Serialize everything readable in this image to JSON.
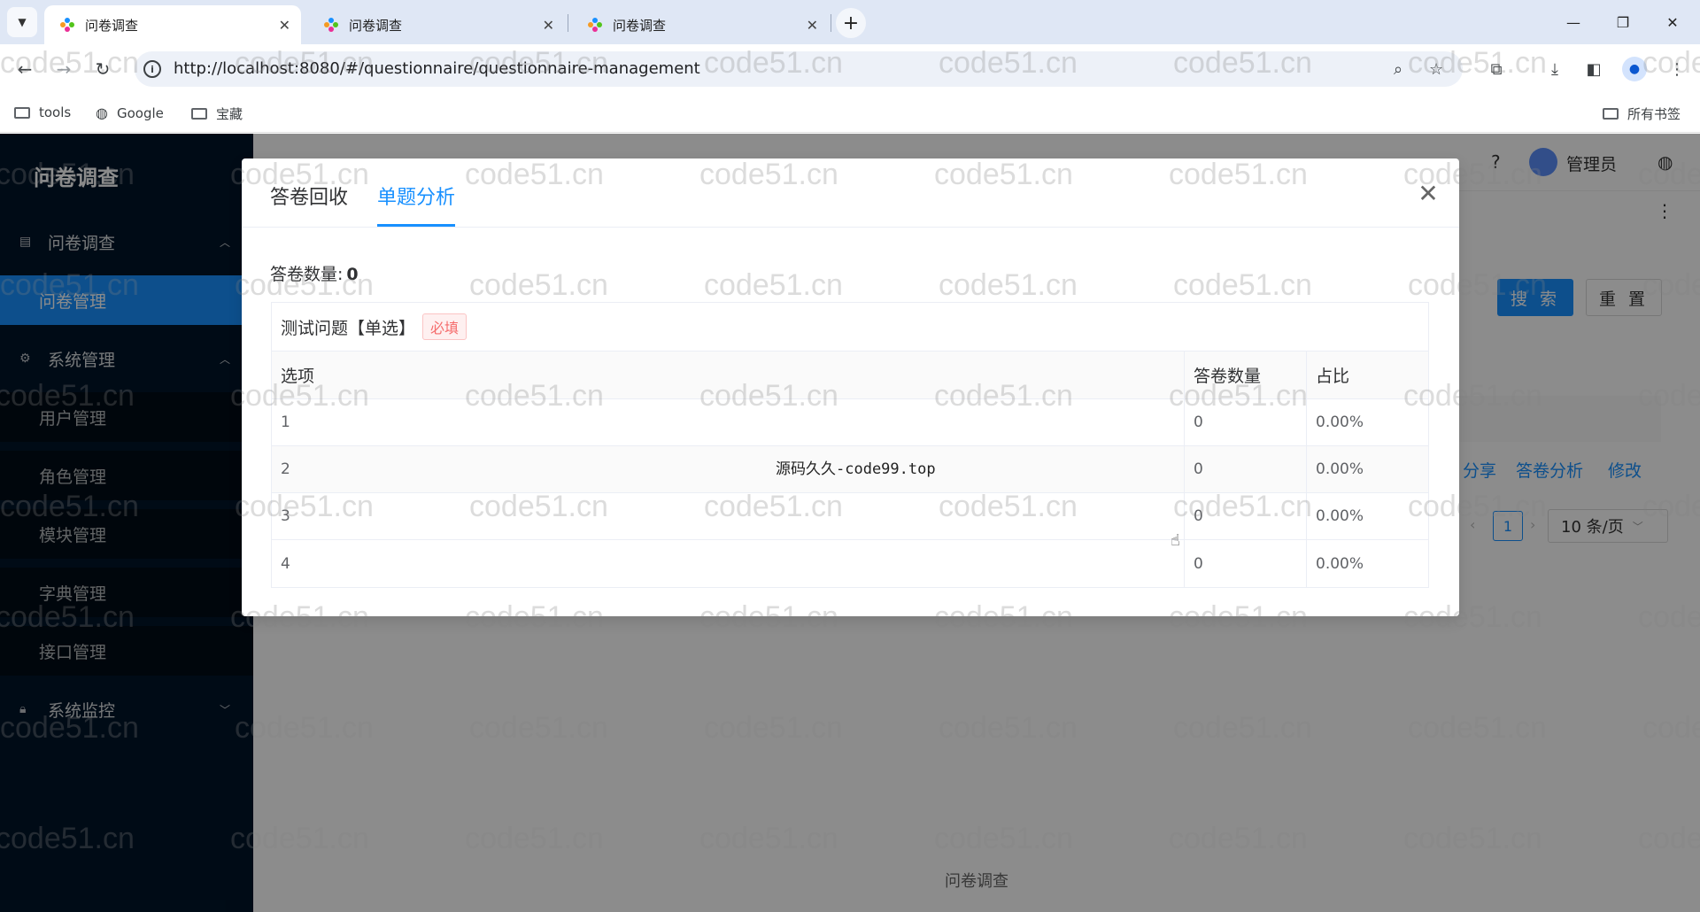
{
  "browser": {
    "tabs": [
      {
        "title": "问卷调查",
        "active": true
      },
      {
        "title": "问卷调查",
        "active": false
      },
      {
        "title": "问卷调查",
        "active": false
      }
    ],
    "url": "http://localhost:8080/#/questionnaire/questionnaire-management",
    "bookmarks": [
      {
        "label": "tools",
        "icon": "folder-icon"
      },
      {
        "label": "Google",
        "icon": "globe-icon"
      },
      {
        "label": "宝藏",
        "icon": "folder-icon"
      }
    ],
    "all_bookmarks_label": "所有书签"
  },
  "sidebar": {
    "title": "问卷调查",
    "groups": [
      {
        "label": "问卷调查",
        "icon": "document-icon",
        "expanded": true,
        "items": [
          {
            "label": "问卷管理",
            "active": true
          }
        ]
      },
      {
        "label": "系统管理",
        "icon": "settings-icon",
        "expanded": true,
        "items": [
          {
            "label": "用户管理"
          },
          {
            "label": "角色管理"
          },
          {
            "label": "模块管理"
          },
          {
            "label": "字典管理"
          },
          {
            "label": "接口管理"
          }
        ]
      },
      {
        "label": "系统监控",
        "icon": "lock-icon",
        "expanded": false,
        "items": []
      }
    ]
  },
  "header": {
    "user_name": "管理员"
  },
  "page": {
    "search_label": "搜 索",
    "reset_label": "重 置",
    "row_actions": [
      "分享",
      "答卷分析",
      "修改"
    ],
    "pager_current": "1",
    "pager_size": "10 条/页",
    "footer": "问卷调查"
  },
  "modal": {
    "tabs": [
      {
        "label": "答卷回收",
        "active": false
      },
      {
        "label": "单题分析",
        "active": true
      }
    ],
    "count_label": "答卷数量:",
    "count_value": "0",
    "question": {
      "title": "测试问题【单选】",
      "required_tag": "必填",
      "columns": [
        "选项",
        "答卷数量",
        "占比"
      ],
      "rows": [
        {
          "option": "1",
          "count": "0",
          "ratio": "0.00%"
        },
        {
          "option": "2",
          "count": "0",
          "ratio": "0.00%"
        },
        {
          "option": "3",
          "count": "0",
          "ratio": "0.00%"
        },
        {
          "option": "4",
          "count": "0",
          "ratio": "0.00%"
        }
      ]
    }
  },
  "overlay_text": "源码久久-code99.top",
  "watermark": "code51.cn",
  "colors": {
    "primary": "#1890ff",
    "sidebar_bg": "#001529",
    "tag_red": "#f56c6c"
  }
}
